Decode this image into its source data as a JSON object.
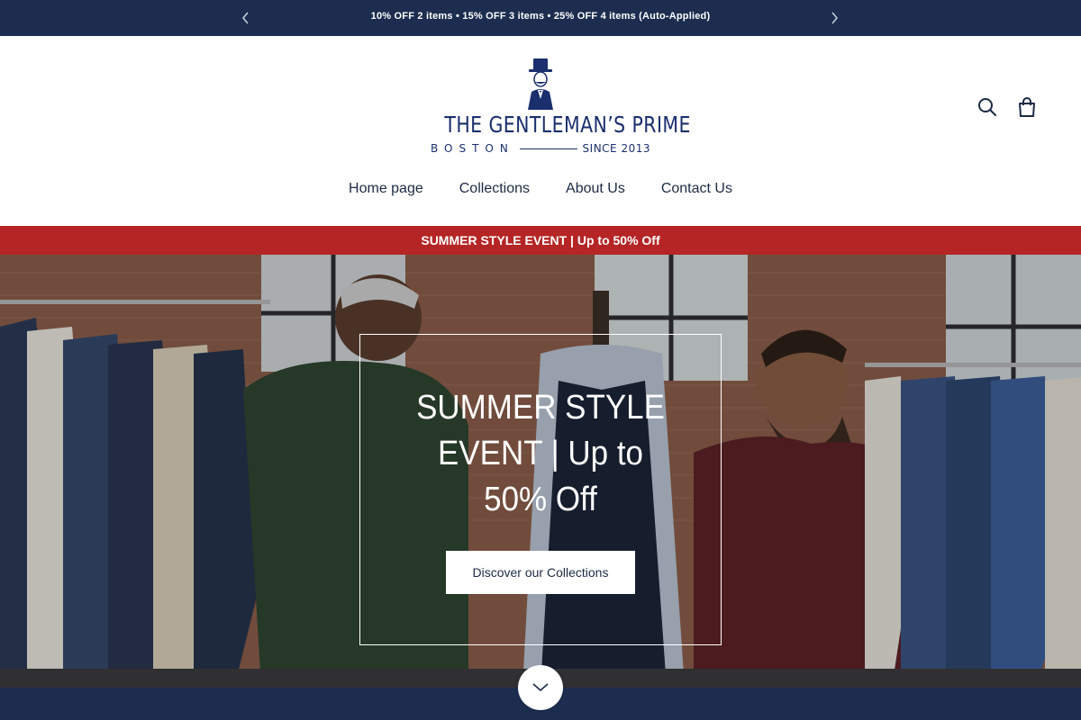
{
  "announcement": {
    "text": "10% OFF 2 items • 15% OFF 3 items • 25% OFF 4 items (Auto-Applied)"
  },
  "logo": {
    "name": "THE GENTLEMAN’S PRIME",
    "city": "BOSTON",
    "since": "SINCE 2013"
  },
  "nav": {
    "items": [
      {
        "label": "Home page"
      },
      {
        "label": "Collections"
      },
      {
        "label": "About Us"
      },
      {
        "label": "Contact Us"
      }
    ]
  },
  "promo": {
    "text": "SUMMER STYLE EVENT | Up to 50% Off"
  },
  "hero": {
    "title": "SUMMER STYLE EVENT | Up to 50% Off",
    "cta_label": "Discover our Collections"
  },
  "icons": {
    "prev": "chevron-left-icon",
    "next": "chevron-right-icon",
    "search": "search-icon",
    "cart": "shopping-bag-icon",
    "scroll": "chevron-down-icon"
  },
  "colors": {
    "navy": "#1c2d4f",
    "brand_blue": "#1b2f6e",
    "promo_red": "#b52525",
    "white": "#ffffff"
  }
}
